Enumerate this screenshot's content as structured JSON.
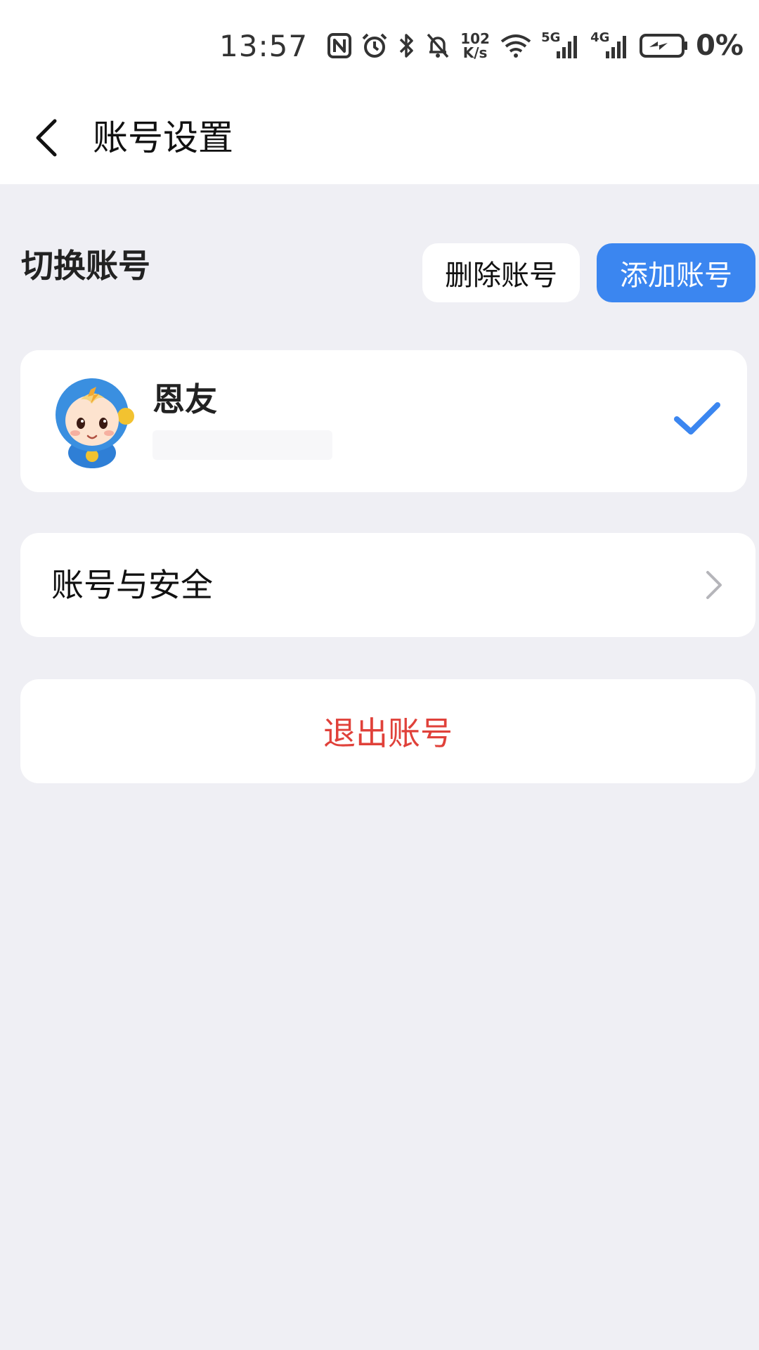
{
  "status_bar": {
    "time": "13:57",
    "net_speed_value": "102",
    "net_speed_unit": "K/s",
    "network_5g": "5G",
    "network_4g": "4G",
    "battery_percent": "0%",
    "icons": [
      "nfc-icon",
      "alarm-icon",
      "bluetooth-icon",
      "mute-icon",
      "wifi-icon",
      "signal-5g-icon",
      "signal-4g-icon",
      "battery-charging-icon"
    ]
  },
  "header": {
    "title": "账号设置",
    "back_icon": "chevron-left-icon"
  },
  "switch_account": {
    "title": "切换账号",
    "delete_label": "删除账号",
    "add_label": "添加账号"
  },
  "account": {
    "name": "恩友",
    "selected_icon": "checkmark-icon",
    "avatar_icon": "mascot-avatar-icon"
  },
  "menu": {
    "security_label": "账号与安全",
    "security_icon": "chevron-right-icon"
  },
  "logout": {
    "label": "退出账号"
  },
  "colors": {
    "background": "#efeff4",
    "primary": "#3b86f0",
    "danger": "#e0413a",
    "card": "#ffffff"
  }
}
